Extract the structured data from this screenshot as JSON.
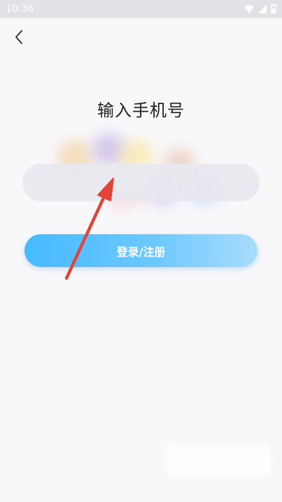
{
  "status_bar": {
    "time": "10:36",
    "icons": [
      "wifi-icon",
      "signal-icon",
      "battery-icon"
    ]
  },
  "header": {
    "back_icon": "chevron-left-icon",
    "title": "输入手机号"
  },
  "form": {
    "phone_value": "",
    "phone_placeholder": "",
    "submit_label": "登录/注册"
  },
  "colors": {
    "accent_start": "#47baff",
    "accent_end": "#a8dcfb",
    "annotation": "#e0453a",
    "background": "#f8f8fb"
  }
}
